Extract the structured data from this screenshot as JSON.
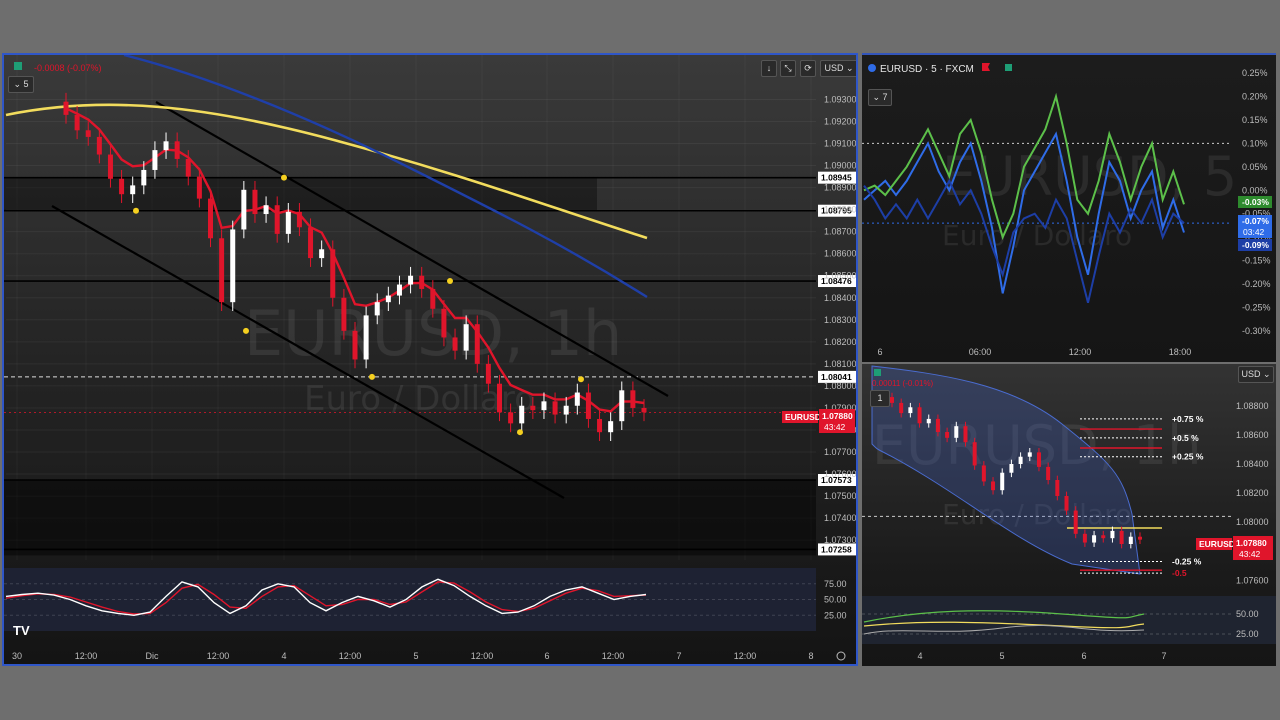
{
  "main": {
    "watermark_symbol": "EURUSD, 1h",
    "watermark_name": "Euro / Dollaro",
    "indicator_value": "-0.0008 (-0.07%)",
    "interval_badge": "5",
    "currency_button": "USD",
    "last_price": "1.07880",
    "countdown": "43:42",
    "symbol_label": "EURUSD",
    "logo": "TV"
  },
  "top_right": {
    "title": "EURUSD · 5 · FXCM",
    "interval_badge": "7",
    "watermark_symbol": "EURUSD, 5",
    "watermark_name": "Euro / Dollaro",
    "green_label": "-0.03%",
    "blue_label": "-0.07%",
    "blue_timer": "03:42",
    "dark_blue_label": "-0.09%"
  },
  "bottom_right": {
    "currency_button": "USD",
    "watermark_symbol": "EURUSD, 1h",
    "watermark_name": "Euro / Dollaro",
    "indicator_value": "0.00011 (-0.01%)",
    "interval_badge": "1",
    "symbol_label": "EURUSD",
    "last_price": "1.07880",
    "countdown": "43:42",
    "levels": [
      "+0.75 %",
      "+0.5 %",
      "+0.25 %",
      "-0.25 %",
      "-0.5"
    ]
  },
  "colors": {
    "candle_up": "#ffffff",
    "candle_down": "#e0152b",
    "ema_red": "#e0152b",
    "ma_yellow": "#f2dc5d",
    "ma_blue": "#1f3fa8",
    "channel": "#000000",
    "green_line": "#5cc04a",
    "blue_line": "#2f6ce8",
    "dark_blue_line": "#1d3ea6",
    "price_tag": "#e0152b"
  },
  "chart_data": [
    {
      "type": "candlestick",
      "title": "EURUSD, 1h",
      "x_ticks": [
        "30",
        "12:00",
        "Dic",
        "12:00",
        "4",
        "12:00",
        "5",
        "12:00",
        "6",
        "12:00",
        "7",
        "12:00",
        "8"
      ],
      "y_ticks": [
        "1.09300",
        "1.09200",
        "1.09100",
        "1.09000",
        "1.08900",
        "1.08800",
        "1.08700",
        "1.08600",
        "1.08500",
        "1.08400",
        "1.08300",
        "1.08200",
        "1.08100",
        "1.08000",
        "1.07900",
        "1.07800",
        "1.07700",
        "1.07600",
        "1.07500",
        "1.07400",
        "1.07300"
      ],
      "ylim": [
        1.0721,
        1.0942
      ],
      "horizontal_levels": [
        1.08945,
        1.08795,
        1.08476,
        1.08041,
        1.07573,
        1.07258
      ],
      "level_labels": [
        "1.08945",
        "1.08795",
        "1.08476",
        "1.08041",
        "1.07573",
        "1.07258"
      ],
      "close_series": [
        1.0923,
        1.0916,
        1.0913,
        1.0905,
        1.0894,
        1.0887,
        1.0891,
        1.0898,
        1.0907,
        1.0911,
        1.0903,
        1.0895,
        1.0885,
        1.0867,
        1.0838,
        1.0871,
        1.0889,
        1.0878,
        1.0882,
        1.0869,
        1.0879,
        1.0872,
        1.0858,
        1.0862,
        1.084,
        1.0825,
        1.0812,
        1.0832,
        1.0838,
        1.0841,
        1.0846,
        1.085,
        1.0844,
        1.0835,
        1.0822,
        1.0816,
        1.0828,
        1.081,
        1.0801,
        1.0788,
        1.0783,
        1.0791,
        1.0789,
        1.0793,
        1.0787,
        1.0791,
        1.0797,
        1.0785,
        1.0779,
        1.0784,
        1.0798,
        1.079,
        1.0788
      ],
      "stochastic": {
        "yticks": [
          "75.00",
          "50.00",
          "25.00"
        ],
        "k": [
          55,
          58,
          60,
          57,
          50,
          40,
          32,
          28,
          25,
          30,
          55,
          78,
          70,
          45,
          28,
          40,
          65,
          75,
          70,
          45,
          32,
          45,
          55,
          48,
          38,
          50,
          70,
          82,
          72,
          55,
          40,
          28,
          30,
          40,
          55,
          65,
          70,
          60,
          50,
          55,
          58
        ],
        "d": [
          52,
          56,
          59,
          58,
          54,
          46,
          38,
          31,
          27,
          28,
          45,
          68,
          74,
          58,
          38,
          36,
          55,
          70,
          72,
          56,
          40,
          42,
          50,
          50,
          42,
          46,
          62,
          78,
          76,
          62,
          46,
          34,
          31,
          36,
          48,
          60,
          68,
          64,
          55,
          56,
          57
        ]
      }
    },
    {
      "type": "line",
      "title": "EURUSD · 5 · FXCM",
      "x_ticks": [
        "6",
        "06:00",
        "12:00",
        "18:00"
      ],
      "y_ticks": [
        "0.25%",
        "0.20%",
        "0.15%",
        "0.10%",
        "0.05%",
        "0.00%",
        "-0.05%",
        "-0.10%",
        "-0.15%",
        "-0.20%",
        "-0.25%",
        "-0.30%"
      ],
      "ylim": [
        -0.33,
        0.28
      ],
      "series": [
        {
          "values": [
            0.0,
            0.01,
            -0.01,
            0.02,
            0.05,
            0.09,
            0.13,
            0.08,
            0.03,
            0.12,
            0.15,
            0.08,
            -0.02,
            -0.1,
            -0.05,
            0.05,
            0.09,
            0.13,
            0.2,
            0.1,
            -0.02,
            -0.05,
            0.02,
            0.12,
            0.06,
            -0.02,
            0.05,
            0.1,
            -0.02,
            0.04,
            -0.03
          ]
        },
        {
          "values": [
            -0.02,
            0.0,
            0.02,
            -0.01,
            0.02,
            0.06,
            0.1,
            0.04,
            0.0,
            0.06,
            0.1,
            0.02,
            -0.08,
            -0.22,
            -0.12,
            0.0,
            0.04,
            0.08,
            0.12,
            0.02,
            -0.1,
            -0.18,
            -0.05,
            0.06,
            0.02,
            -0.06,
            0.0,
            0.04,
            -0.08,
            -0.02,
            -0.09
          ]
        },
        {
          "values": [
            0.01,
            -0.02,
            -0.06,
            -0.03,
            -0.06,
            -0.02,
            -0.06,
            -0.02,
            0.02,
            -0.03,
            0.0,
            -0.05,
            -0.12,
            -0.18,
            -0.09,
            -0.06,
            -0.05,
            -0.08,
            -0.02,
            -0.06,
            -0.15,
            -0.24,
            -0.14,
            -0.05,
            -0.09,
            -0.04,
            -0.07,
            -0.02,
            -0.1,
            -0.05,
            -0.07
          ]
        }
      ]
    },
    {
      "type": "candlestick",
      "title": "EURUSD, 1h",
      "x_ticks": [
        "4",
        "5",
        "6",
        "7"
      ],
      "y_ticks": [
        "1.08800",
        "1.08600",
        "1.08400",
        "1.08200",
        "1.08000",
        "1.07800",
        "1.07600"
      ],
      "ylim": [
        1.0752,
        1.0895
      ],
      "close_series": [
        1.0882,
        1.0875,
        1.0879,
        1.0868,
        1.0871,
        1.0862,
        1.0858,
        1.0866,
        1.0855,
        1.0839,
        1.0828,
        1.0822,
        1.0834,
        1.084,
        1.0845,
        1.0848,
        1.0838,
        1.0829,
        1.0818,
        1.0808,
        1.0792,
        1.0786,
        1.0791,
        1.0789,
        1.0794,
        1.0785,
        1.079,
        1.0788
      ],
      "level_labels": [
        "+0.75 %",
        "+0.5 %",
        "+0.25 %",
        "-0.25 %",
        "-0.5"
      ],
      "oscillator_yticks": [
        "50.00",
        "25.00"
      ]
    }
  ]
}
